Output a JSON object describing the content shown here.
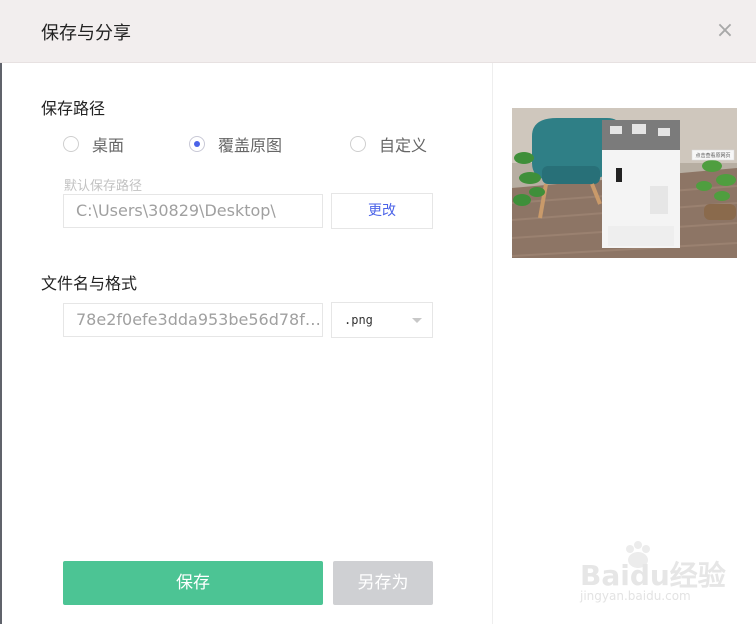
{
  "dialog": {
    "title": "保存与分享",
    "close_glyph": "×"
  },
  "save_path": {
    "section_title": "保存路径",
    "options": [
      {
        "label": "桌面",
        "checked": false
      },
      {
        "label": "覆盖原图",
        "checked": true
      },
      {
        "label": "自定义",
        "checked": false
      }
    ],
    "hint": "默认保存路径",
    "path_value": "C:\\Users\\30829\\Desktop\\",
    "change_label": "更改"
  },
  "file": {
    "section_title": "文件名与格式",
    "filename_value": "78e2f0efe3dda953be56d78f46...",
    "format_selected": ".png"
  },
  "actions": {
    "save_label": "保存",
    "save_as_label": "另存为"
  },
  "preview": {
    "tag_text": "点击查看原网页"
  },
  "watermark": {
    "text": "Baidu经验",
    "sub": "jingyan.baidu.com"
  },
  "colors": {
    "accent_blue": "#4b63e8",
    "save_green": "#4cc494",
    "disabled_gray": "#cfd0d3",
    "header_bg": "#f2eeee"
  },
  "icons": {
    "close": "close-icon",
    "dropdown": "chevron-down-icon",
    "baidu_paw": "paw-icon"
  }
}
